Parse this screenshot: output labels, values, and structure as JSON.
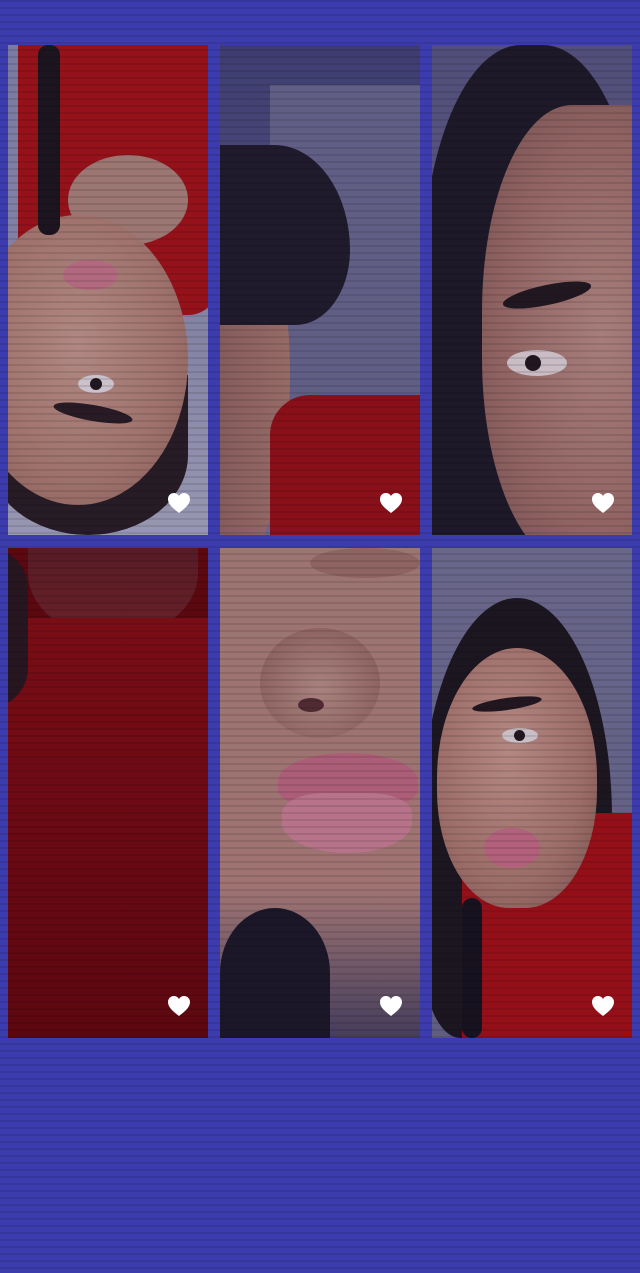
{
  "screen": {
    "background_color": "#3c3caf"
  },
  "gallery": {
    "items": [
      {
        "alt": "",
        "liked_icon": "heart-icon"
      },
      {
        "alt": "",
        "liked_icon": "heart-icon"
      },
      {
        "alt": "",
        "liked_icon": "heart-icon"
      },
      {
        "alt": "",
        "liked_icon": "heart-icon"
      },
      {
        "alt": "",
        "liked_icon": "heart-icon"
      },
      {
        "alt": "",
        "liked_icon": "heart-icon"
      }
    ],
    "heart_color": "#ffffff"
  }
}
